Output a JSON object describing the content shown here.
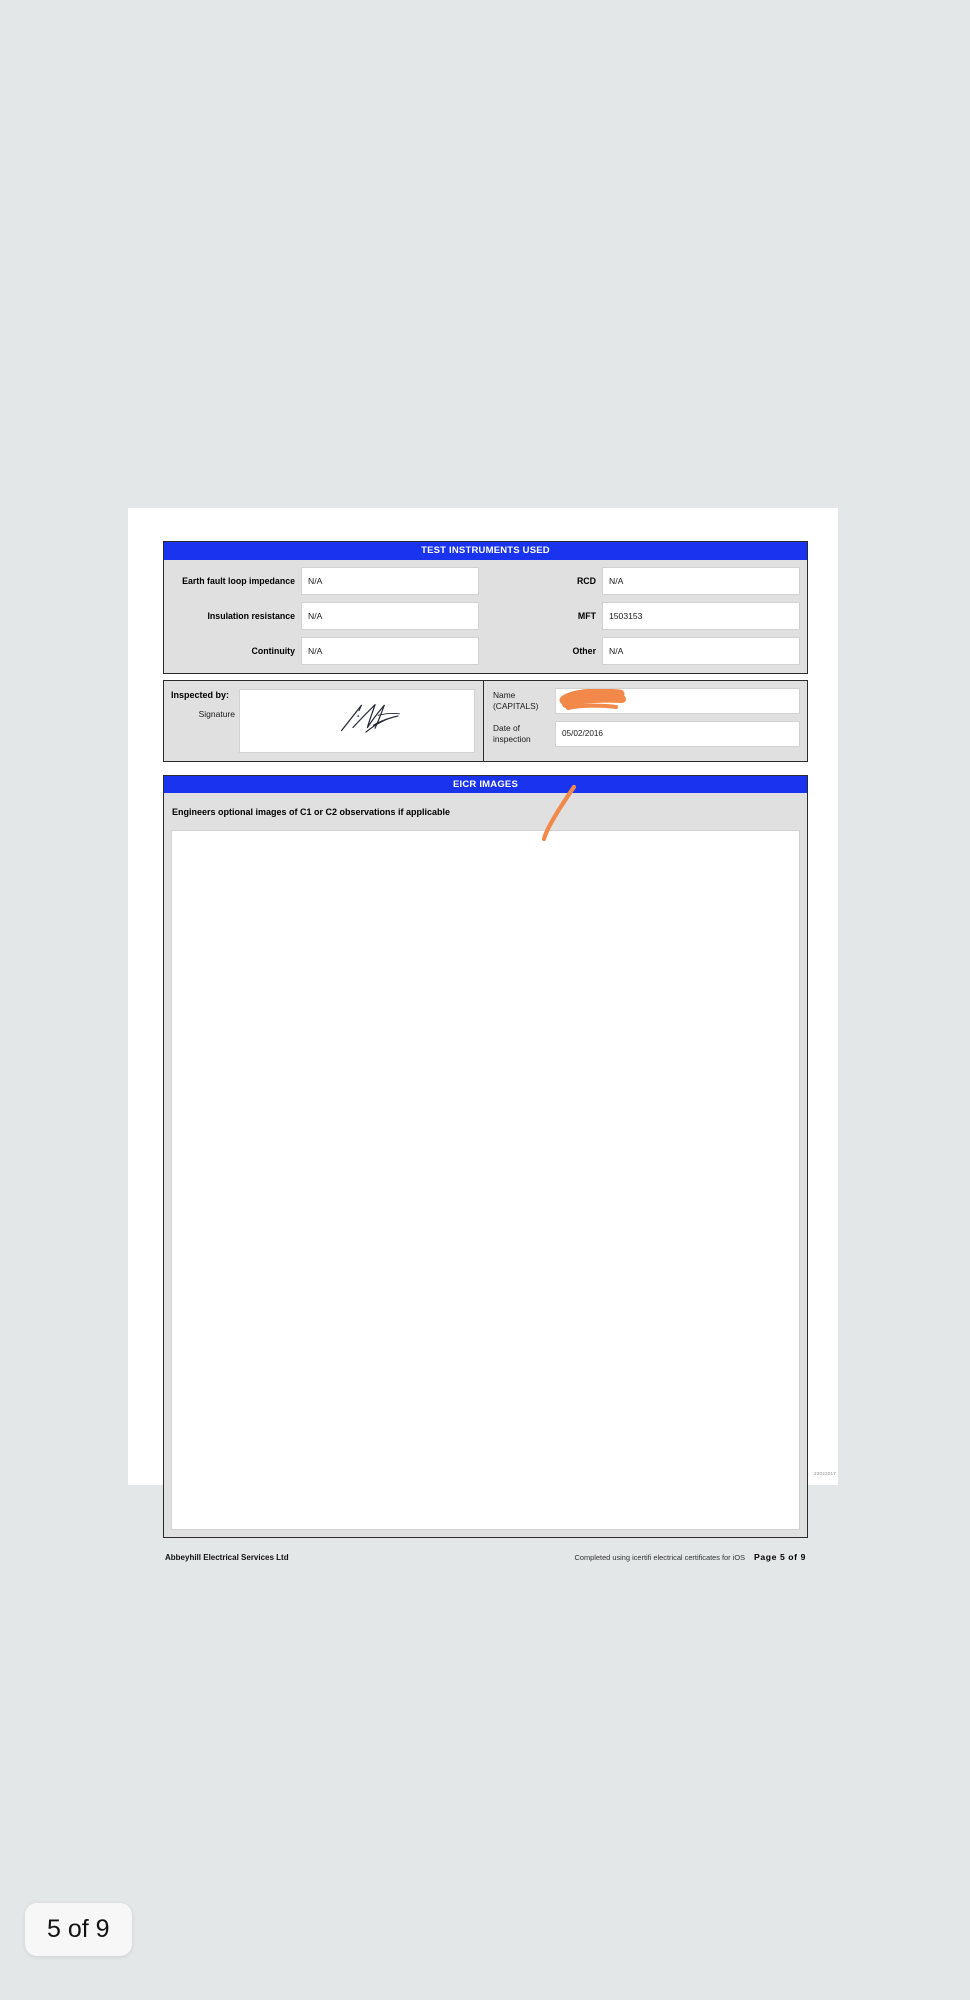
{
  "document": {
    "sections": {
      "test_instruments": {
        "header": "TEST INSTRUMENTS USED",
        "rows": [
          {
            "left_label": "Earth fault loop impedance",
            "left_value": "N/A",
            "right_label": "RCD",
            "right_value": "N/A"
          },
          {
            "left_label": "Insulation resistance",
            "left_value": "N/A",
            "right_label": "MFT",
            "right_value": "1503153"
          },
          {
            "left_label": "Continuity",
            "left_value": "N/A",
            "right_label": "Other",
            "right_value": "N/A"
          }
        ]
      },
      "inspected_by": {
        "title": "Inspected by:",
        "signature_label": "Signature",
        "signature_value": "",
        "name_label": "Name (CAPITALS)",
        "name_value": "",
        "date_label": "Date of inspection",
        "date_value": "05/02/2016"
      },
      "eicr_images": {
        "header": "EICR IMAGES",
        "caption": "Engineers optional images of  C1 or C2 observations if applicable",
        "photo_placeholder": ""
      }
    },
    "footer": {
      "company": "Abbeyhill Electrical Services Ltd",
      "note": "Completed using icertifi electrical certificates for iOS",
      "page_label": "Page  5  of  9",
      "code": "22022017"
    }
  },
  "viewer": {
    "page_indicator": "5 of 9"
  },
  "colors": {
    "header_blue": "#1a33ee",
    "section_grey": "#e0e0e0",
    "app_background": "#e4e7e7",
    "annotation_orange": "#f2894a"
  }
}
